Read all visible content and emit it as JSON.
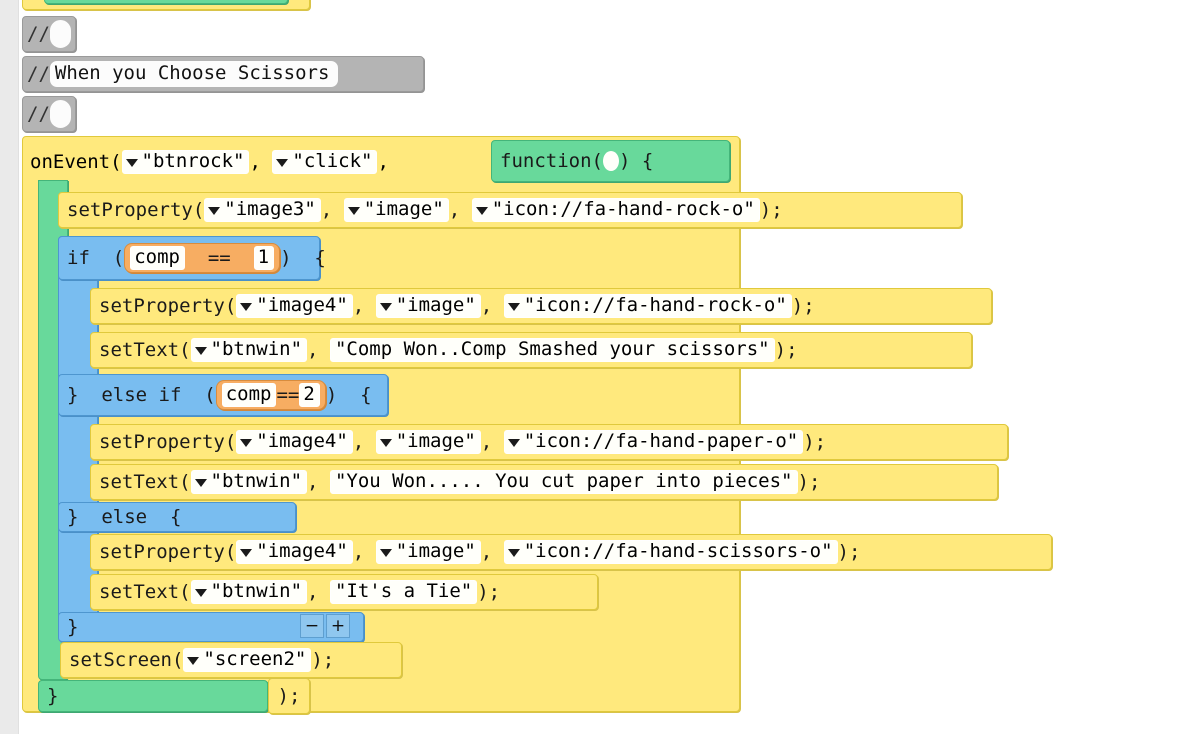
{
  "editor": {
    "name": "code.org-applab-block-workspace",
    "background": "#ffffff",
    "gutter_color": "#eaeaea"
  },
  "colors": {
    "statement_yellow": "#ffe97d",
    "function_green": "#68d99b",
    "control_blue": "#79bdf0",
    "comparison_orange": "#f7ad62",
    "comment_gray": "#b4b4b4",
    "field_white": "#fffffa"
  },
  "blocks": {
    "comment_top_empty_1": {
      "prefix": "//",
      "value": ""
    },
    "comment_label": {
      "prefix": "//",
      "value": "When you Choose Scissors"
    },
    "comment_top_empty_2": {
      "prefix": "//",
      "value": ""
    },
    "on_event": {
      "name": "onEvent(",
      "element": "\"btnrock\"",
      "comma1": ",",
      "event": "\"click\"",
      "comma2": ",",
      "function_header": "function(",
      "function_tail": ") {",
      "closing": ");",
      "closing_brace": "}"
    },
    "set_property_1": {
      "name": "setProperty(",
      "element": "\"image3\"",
      "comma1": ",",
      "property": "\"image\"",
      "comma2": ",",
      "value": "\"icon://fa-hand-rock-o\"",
      "tail": ");"
    },
    "if_block": {
      "keyword_if": "if  (",
      "keyword_tail": ")  {",
      "condition": {
        "left": "comp",
        "operator": "==",
        "right": "1"
      }
    },
    "if_body": {
      "set_property": {
        "name": "setProperty(",
        "element": "\"image4\"",
        "comma1": ",",
        "property": "\"image\"",
        "comma2": ",",
        "value": "\"icon://fa-hand-rock-o\"",
        "tail": ");"
      },
      "set_text": {
        "name": "setText(",
        "element": "\"btnwin\"",
        "comma1": ",",
        "value": "\"Comp Won..Comp Smashed your scissors\"",
        "tail": ");"
      }
    },
    "else_if_block": {
      "keyword": "}  else if  (",
      "keyword_tail": ")  {",
      "condition": {
        "left": "comp",
        "operator": "==",
        "right": "2"
      }
    },
    "else_if_body": {
      "set_property": {
        "name": "setProperty(",
        "element": "\"image4\"",
        "comma1": ",",
        "property": "\"image\"",
        "comma2": ",",
        "value": "\"icon://fa-hand-paper-o\"",
        "tail": ");"
      },
      "set_text": {
        "name": "setText(",
        "element": "\"btnwin\"",
        "comma1": ",",
        "value": "\"You Won..... You cut paper into pieces\"",
        "tail": ");"
      }
    },
    "else_block": {
      "keyword": "}  else  {"
    },
    "else_body": {
      "set_property": {
        "name": "setProperty(",
        "element": "\"image4\"",
        "comma1": ",",
        "property": "\"image\"",
        "comma2": ",",
        "value": "\"icon://fa-hand-scissors-o\"",
        "tail": ");"
      },
      "set_text": {
        "name": "setText(",
        "element": "\"btnwin\"",
        "comma1": ",",
        "value": "\"It's a Tie\"",
        "tail": ");"
      }
    },
    "if_close": {
      "keyword": "}"
    },
    "mutator": {
      "minus": "−",
      "plus": "+"
    },
    "set_screen": {
      "name": "setScreen(",
      "screen": "\"screen2\"",
      "tail": ");"
    }
  }
}
